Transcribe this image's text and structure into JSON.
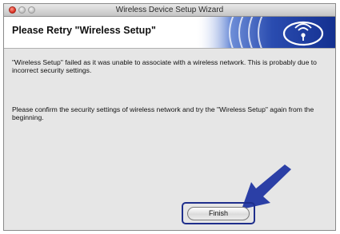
{
  "window": {
    "title": "Wireless Device Setup Wizard"
  },
  "banner": {
    "heading": "Please Retry \"Wireless Setup\"",
    "logo_icon": "wireless-signal-icon"
  },
  "messages": {
    "line1": "\"Wireless Setup\" failed as it was unable to associate with a wireless network. This is probably due to incorrect security settings.",
    "line2": "Please confirm the security settings of wireless network and try the \"Wireless Setup\" again from the beginning."
  },
  "buttons": {
    "finish_label": "Finish"
  },
  "colors": {
    "banner_blue": "#1a3a9c",
    "arrow_blue": "#2b3fa6",
    "highlight_ring": "#1f2f8c"
  }
}
